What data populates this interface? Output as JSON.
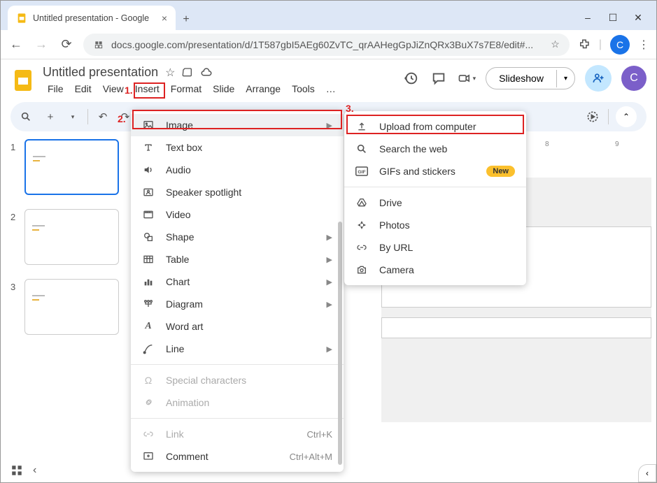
{
  "browser": {
    "tab_title": "Untitled presentation - Google",
    "url": "docs.google.com/presentation/d/1T587gbI5AEg60ZvTC_qrAAHegGpJiZnQRx3BuX7s7E8/edit#..."
  },
  "app": {
    "doc_title": "Untitled presentation",
    "menubar": [
      "File",
      "Edit",
      "View",
      "Insert",
      "Format",
      "Slide",
      "Arrange",
      "Tools",
      "…"
    ],
    "slideshow_btn": "Slideshow",
    "account_letter": "C",
    "av_letter": "C"
  },
  "slides": [
    {
      "num": "1"
    },
    {
      "num": "2"
    },
    {
      "num": "3"
    }
  ],
  "ruler": {
    "m8": "8",
    "m9": "9"
  },
  "insert_menu": {
    "image": "Image",
    "text_box": "Text box",
    "audio": "Audio",
    "speaker_spotlight": "Speaker spotlight",
    "video": "Video",
    "shape": "Shape",
    "table": "Table",
    "chart": "Chart",
    "diagram": "Diagram",
    "word_art": "Word art",
    "line": "Line",
    "special_characters": "Special characters",
    "animation": "Animation",
    "link": "Link",
    "link_short": "Ctrl+K",
    "comment": "Comment",
    "comment_short": "Ctrl+Alt+M"
  },
  "image_menu": {
    "upload": "Upload from computer",
    "search": "Search the web",
    "gifs": "GIFs and stickers",
    "new_badge": "New",
    "drive": "Drive",
    "photos": "Photos",
    "by_url": "By URL",
    "camera": "Camera"
  },
  "annotations": {
    "a1": "1.",
    "a2": "2.",
    "a3": "3."
  }
}
